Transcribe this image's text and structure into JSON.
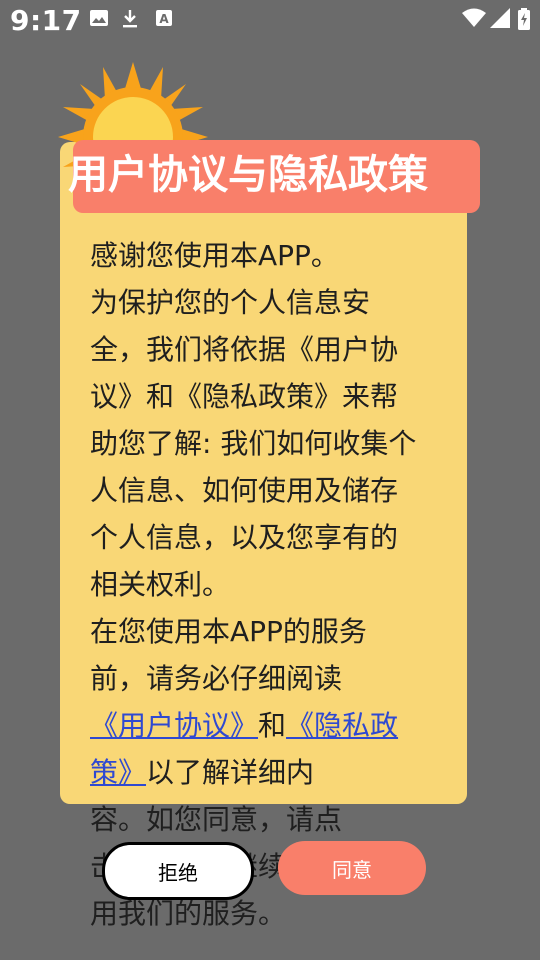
{
  "status_bar": {
    "time": "9:17",
    "icons": [
      "image-icon",
      "download-icon",
      "font-a-icon",
      "wifi-icon",
      "signal-icon",
      "battery-charging-icon"
    ]
  },
  "dialog": {
    "title": "用户协议与隐私政策",
    "intro": "感谢您使用本APP。",
    "body": "为保护您的个人信息安全，我们将依据《用户协议》和《隐私政策》来帮助您了解: 我们如何收集个人信息、如何使用及储存个人信息，以及您享有的相关权利。",
    "before_links": "在您使用本APP的服务前，请务必仔细阅读",
    "link_user_agreement": "《用户协议》",
    "conjunction": "和",
    "link_privacy_policy": "《隐私政策》",
    "after_links": "以了解详细内容。如您同意，请点击同意开始接受我们的服务。",
    "overflow_line1": "容。如您同意，请点",
    "overflow_line2": "击同意开始继续使用",
    "overflow_line3": "用我们的服务。"
  },
  "buttons": {
    "reject": "拒绝",
    "agree": "同意"
  },
  "colors": {
    "backdrop": "#6b6b6b",
    "card": "#f9d776",
    "title_banner": "#f97f6a",
    "link": "#2f49d1",
    "agree_button": "#f97f6a"
  }
}
